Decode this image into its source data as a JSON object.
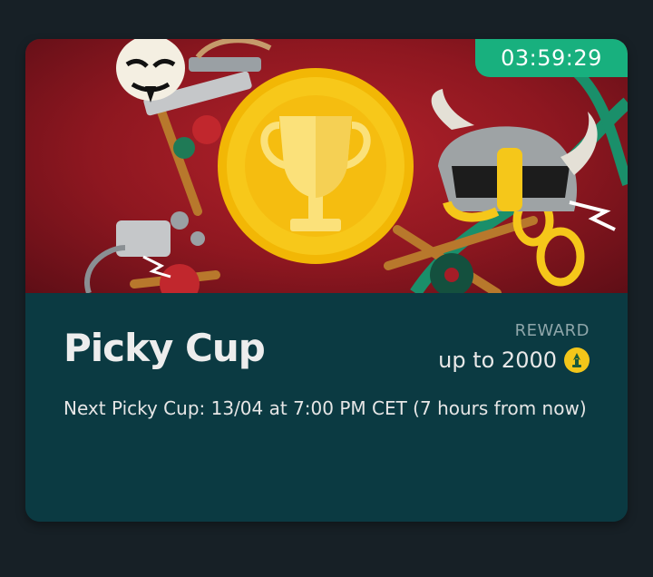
{
  "event_card": {
    "timer": "03:59:29",
    "title": "Picky Cup",
    "reward_label": "REWARD",
    "reward_value": "up to 2000",
    "reward_icon": "token-coin-icon",
    "description": "Next Picky Cup: 13/04 at 7:00 PM CET (7 hours from now)"
  },
  "colors": {
    "page_background": "#172026",
    "card_background": "#0b3a42",
    "timer_badge": "#18b07e",
    "banner_red": "#a51d27",
    "trophy_coin": "#f5c71a"
  }
}
